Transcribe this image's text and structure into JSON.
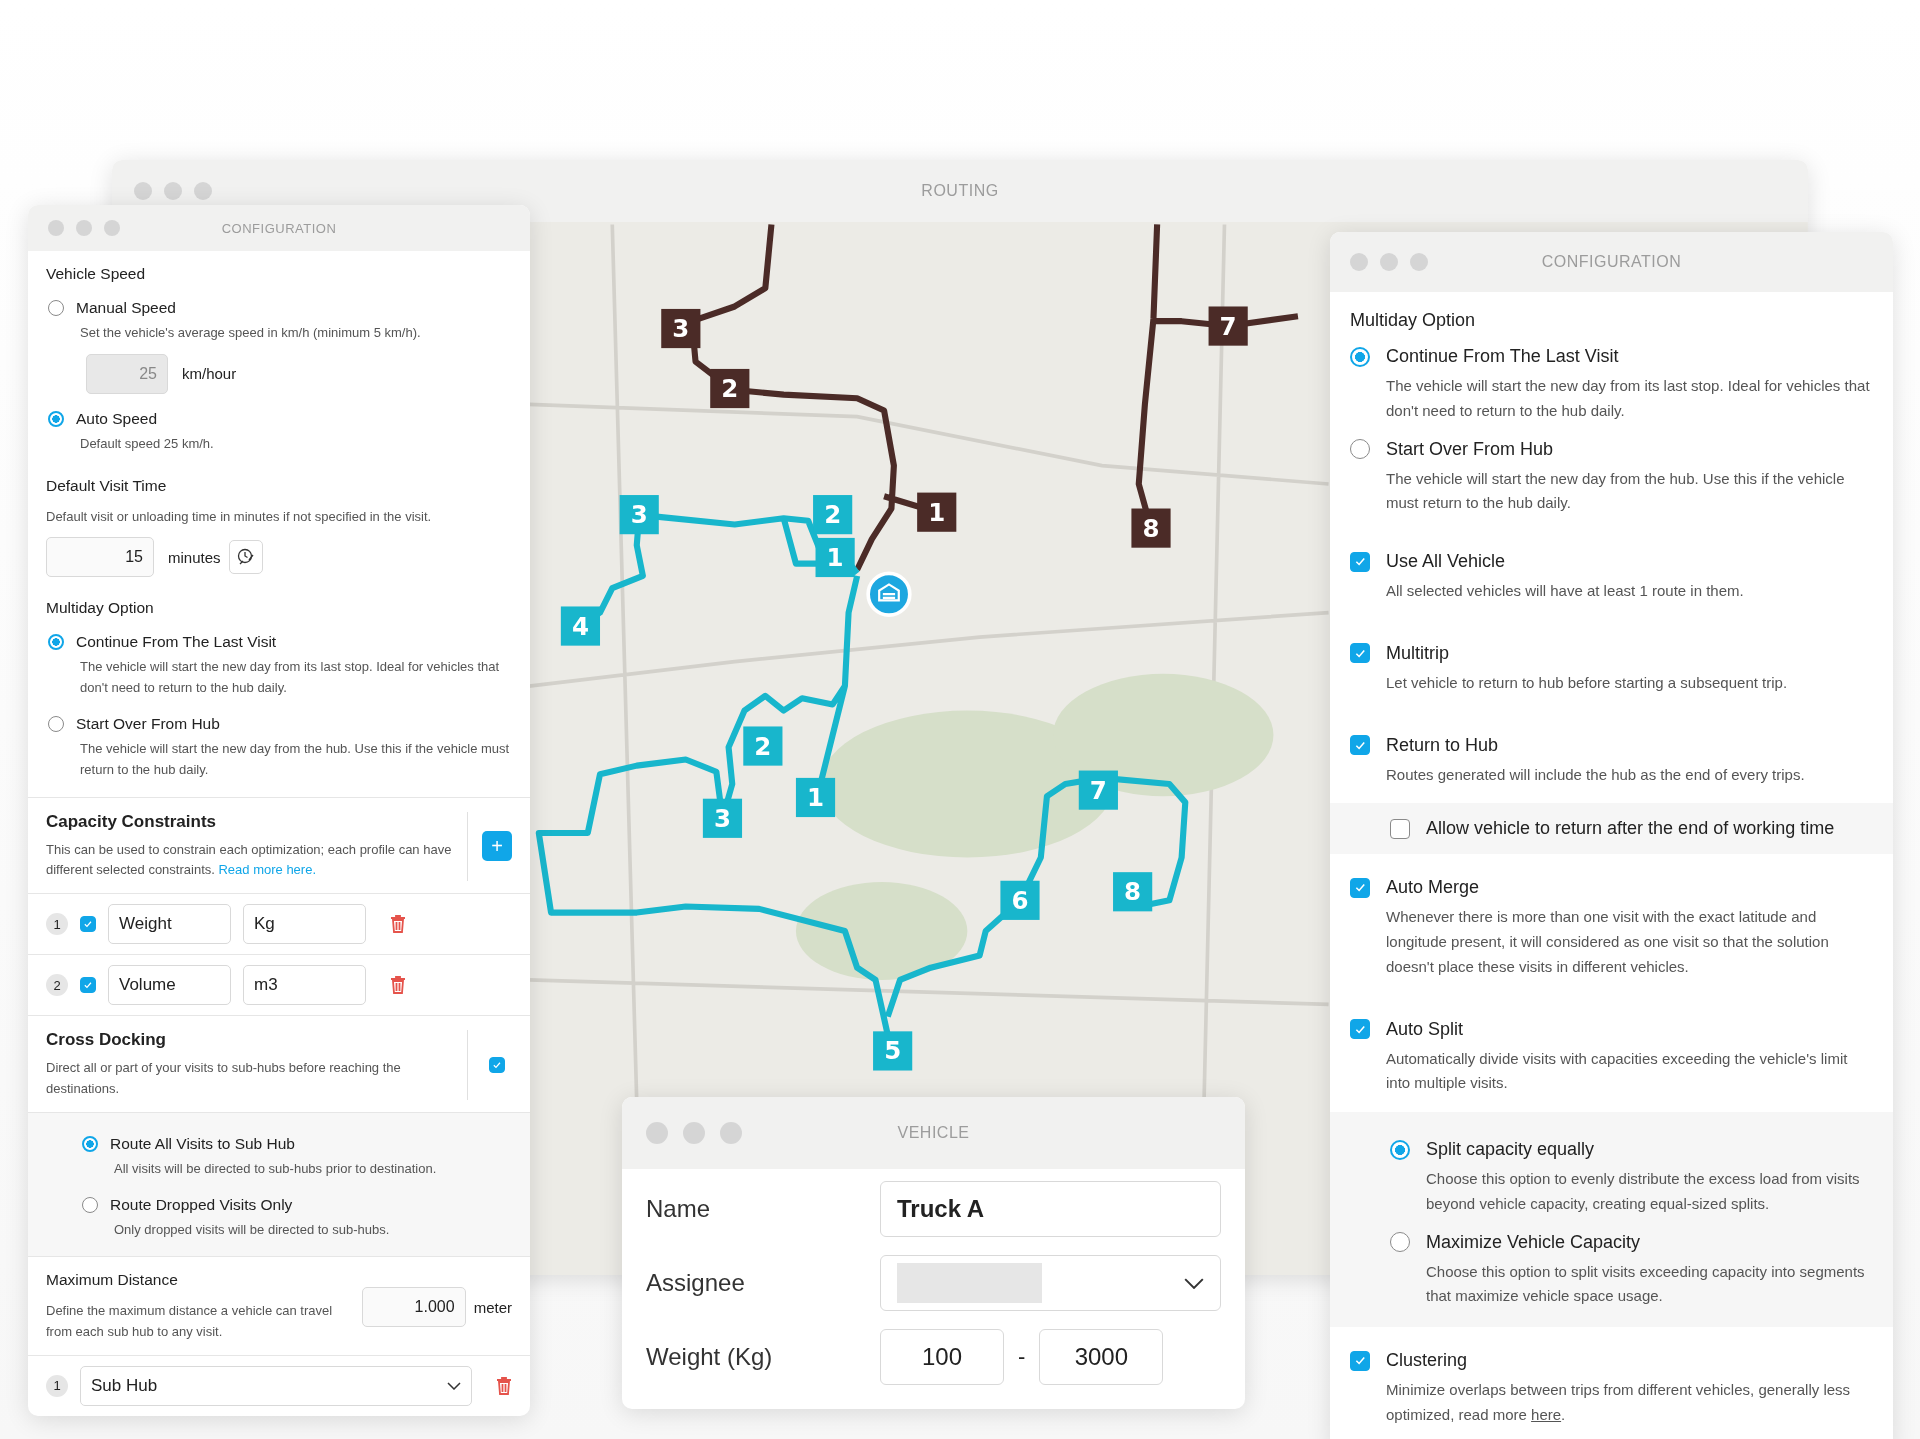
{
  "routing_window": {
    "title": "ROUTING"
  },
  "map": {
    "routes": [
      {
        "color": "#4b2b27",
        "stops": [
          "1",
          "2",
          "3",
          "7",
          "8"
        ]
      },
      {
        "color": "#18b6cc",
        "stops": [
          "1",
          "2",
          "3",
          "4"
        ]
      },
      {
        "color": "#18b6cc",
        "stops": [
          "1",
          "2",
          "3",
          "5",
          "6",
          "7",
          "8"
        ]
      }
    ]
  },
  "left_config": {
    "title": "CONFIGURATION",
    "vehicle_speed": {
      "heading": "Vehicle Speed",
      "options": [
        {
          "label": "Manual Speed",
          "description": "Set the vehicle's average speed in km/h (minimum 5 km/h).",
          "selected": false,
          "input": {
            "value": "25",
            "unit": "km/hour",
            "disabled": true
          }
        },
        {
          "label": "Auto Speed",
          "description": "Default speed 25 km/h.",
          "selected": true
        }
      ]
    },
    "default_visit_time": {
      "heading": "Default Visit Time",
      "description": "Default visit or unloading time in minutes if not specified in the visit.",
      "value": "15",
      "unit": "minutes"
    },
    "multiday": {
      "heading": "Multiday Option",
      "options": [
        {
          "label": "Continue From The Last Visit",
          "description": "The vehicle will start the new day from its last stop. Ideal for vehicles that don't need to return to the hub daily.",
          "selected": true
        },
        {
          "label": "Start Over From Hub",
          "description": "The vehicle will start the new day from the hub. Use this if the vehicle must return to the hub daily.",
          "selected": false
        }
      ]
    },
    "capacity": {
      "heading": "Capacity Constraints",
      "description": "This can be used to constrain each optimization; each profile can have different selected constraints. ",
      "link": "Read more here.",
      "add_button": "+",
      "rows": [
        {
          "index": "1",
          "checked": true,
          "name": "Weight",
          "unit": "Kg"
        },
        {
          "index": "2",
          "checked": true,
          "name": "Volume",
          "unit": "m3"
        }
      ]
    },
    "cross_docking": {
      "heading": "Cross Docking",
      "description": "Direct all or part of your visits to sub-hubs before reaching the destinations.",
      "checked": true,
      "options": [
        {
          "label": "Route All Visits to Sub Hub",
          "description": "All visits will be directed to sub-hubs prior to destination.",
          "selected": true
        },
        {
          "label": "Route Dropped Visits Only",
          "description": "Only dropped visits will be directed to sub-hubs.",
          "selected": false
        }
      ]
    },
    "max_distance": {
      "heading": "Maximum Distance",
      "description": "Define the maximum distance a vehicle can travel from each sub hub to any visit.",
      "value": "1.000",
      "unit": "meter"
    },
    "sub_hubs": [
      {
        "index": "1",
        "value": "Sub Hub"
      }
    ]
  },
  "vehicle_window": {
    "title": "VEHICLE",
    "fields": [
      {
        "kind": "text",
        "label": "Name",
        "value": "Truck A"
      },
      {
        "kind": "select",
        "label": "Assignee"
      },
      {
        "kind": "range",
        "label": "Weight (Kg)",
        "min": "100",
        "separator": "-",
        "max": "3000"
      }
    ]
  },
  "right_config": {
    "title": "CONFIGURATION",
    "multiday": {
      "heading": "Multiday Option",
      "options": [
        {
          "label": "Continue From The Last Visit",
          "description": "The vehicle will start the new day from its last stop. Ideal for vehicles that don't need to return to the hub daily.",
          "selected": true
        },
        {
          "label": "Start Over From Hub",
          "description": "The vehicle will start the new day from the hub. Use this if the vehicle must return to the hub daily.",
          "selected": false
        }
      ]
    },
    "settings": [
      {
        "label": "Use All Vehicle",
        "description": "All selected vehicles will have at least 1 route in them.",
        "checked": true
      },
      {
        "label": "Multitrip",
        "description": "Let vehicle to return to hub before starting a subsequent trip.",
        "checked": true
      },
      {
        "label": "Return to Hub",
        "description": "Routes generated will include the hub as the end of every trips.",
        "checked": true,
        "sub": [
          {
            "kind": "checkbox",
            "label": "Allow vehicle to return after the end of working time",
            "checked": false
          }
        ]
      },
      {
        "label": "Auto Merge",
        "description": "Whenever there is more than one visit with the exact latitude and longitude present, it will considered as one visit so that the solution doesn't place these visits in different vehicles.",
        "checked": true
      },
      {
        "label": "Auto Split",
        "description": "Automatically divide visits with capacities exceeding the vehicle's limit into multiple visits.",
        "checked": true,
        "sub": [
          {
            "kind": "radio",
            "label": "Split capacity equally",
            "description": "Choose this option to evenly distribute the excess load from visits beyond vehicle capacity, creating equal-sized splits.",
            "selected": true
          },
          {
            "kind": "radio",
            "label": "Maximize Vehicle Capacity",
            "description": "Choose this option to split visits exceeding capacity into segments that maximize vehicle space usage.",
            "selected": false
          }
        ]
      },
      {
        "label": "Clustering",
        "description": "Minimize overlaps between trips from different vehicles, generally less optimized, read more ",
        "link": "here",
        "description_end": ".",
        "checked": true
      }
    ]
  }
}
